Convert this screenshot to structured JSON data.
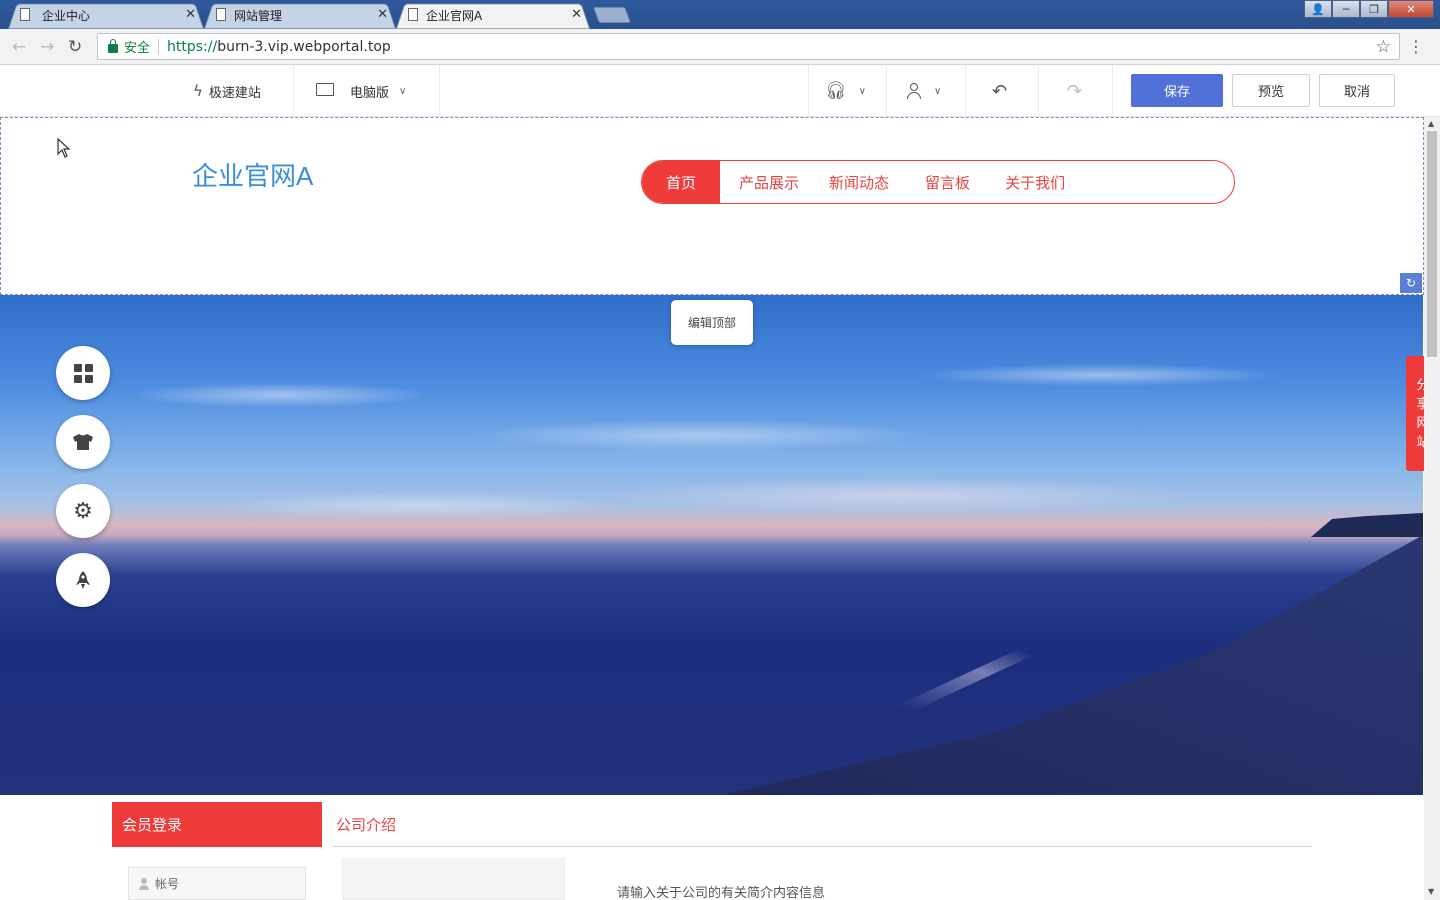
{
  "browser": {
    "tabs": [
      {
        "title": "企业中心",
        "active": false
      },
      {
        "title": "网站管理",
        "active": false
      },
      {
        "title": "企业官网A",
        "active": true
      }
    ],
    "close_glyph": "✕",
    "security_label": "安全",
    "url_scheme": "https://",
    "url_rest": "burn-3.vip.webportal.top"
  },
  "toolbar": {
    "quick_build_label": "极速建站",
    "device_label": "电脑版",
    "save_label": "保存",
    "preview_label": "预览",
    "cancel_label": "取消"
  },
  "site": {
    "logo_text": "企业官网A",
    "nav": [
      {
        "label": "首页",
        "active": true
      },
      {
        "label": "产品展示",
        "active": false
      },
      {
        "label": "新闻动态",
        "active": false
      },
      {
        "label": "留言板",
        "active": false
      },
      {
        "label": "关于我们",
        "active": false
      }
    ],
    "accent_color": "#ef3a3a",
    "logo_color": "#3b8fd6"
  },
  "editor": {
    "edit_top_label": "编辑顶部",
    "side_tools": [
      "grid-icon",
      "shirt-icon",
      "gear-icon",
      "rocket-icon"
    ],
    "share_label": [
      "分",
      "享",
      "网",
      "站"
    ]
  },
  "content": {
    "member_title": "会员登录",
    "about_title": "公司介绍",
    "account_placeholder": "帐号",
    "about_text": "请输入关于公司的有关简介内容信息"
  }
}
